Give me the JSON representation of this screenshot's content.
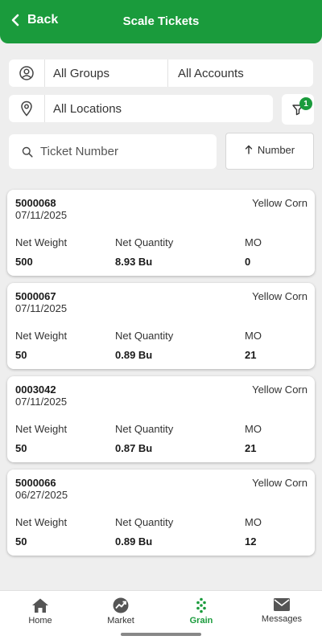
{
  "header": {
    "back_label": "Back",
    "title": "Scale Tickets",
    "accent": "#1a9b3c"
  },
  "filters": {
    "groups": "All Groups",
    "accounts": "All Accounts",
    "locations": "All Locations",
    "filter_count": "1"
  },
  "search": {
    "placeholder": "Ticket Number"
  },
  "sort": {
    "label": "Number",
    "direction": "ascending"
  },
  "tickets": [
    {
      "number": "5000068",
      "date": "07/11/2025",
      "commodity": "Yellow Corn",
      "net_weight_label": "Net Weight",
      "net_quantity_label": "Net Quantity",
      "mo_label": "MO",
      "net_weight": "500",
      "net_quantity": "8.93 Bu",
      "mo": "0"
    },
    {
      "number": "5000067",
      "date": "07/11/2025",
      "commodity": "Yellow Corn",
      "net_weight_label": "Net Weight",
      "net_quantity_label": "Net Quantity",
      "mo_label": "MO",
      "net_weight": "50",
      "net_quantity": "0.89 Bu",
      "mo": "21"
    },
    {
      "number": "0003042",
      "date": "07/11/2025",
      "commodity": "Yellow Corn",
      "net_weight_label": "Net Weight",
      "net_quantity_label": "Net Quantity",
      "mo_label": "MO",
      "net_weight": "50",
      "net_quantity": "0.87 Bu",
      "mo": "21"
    },
    {
      "number": "5000066",
      "date": "06/27/2025",
      "commodity": "Yellow Corn",
      "net_weight_label": "Net Weight",
      "net_quantity_label": "Net Quantity",
      "mo_label": "MO",
      "net_weight": "50",
      "net_quantity": "0.89 Bu",
      "mo": "12"
    }
  ],
  "nav": [
    {
      "label": "Home",
      "icon": "home-icon",
      "active": false
    },
    {
      "label": "Market",
      "icon": "market-icon",
      "active": false
    },
    {
      "label": "Grain",
      "icon": "grain-icon",
      "active": true
    },
    {
      "label": "Messages",
      "icon": "mail-icon",
      "active": false
    }
  ]
}
